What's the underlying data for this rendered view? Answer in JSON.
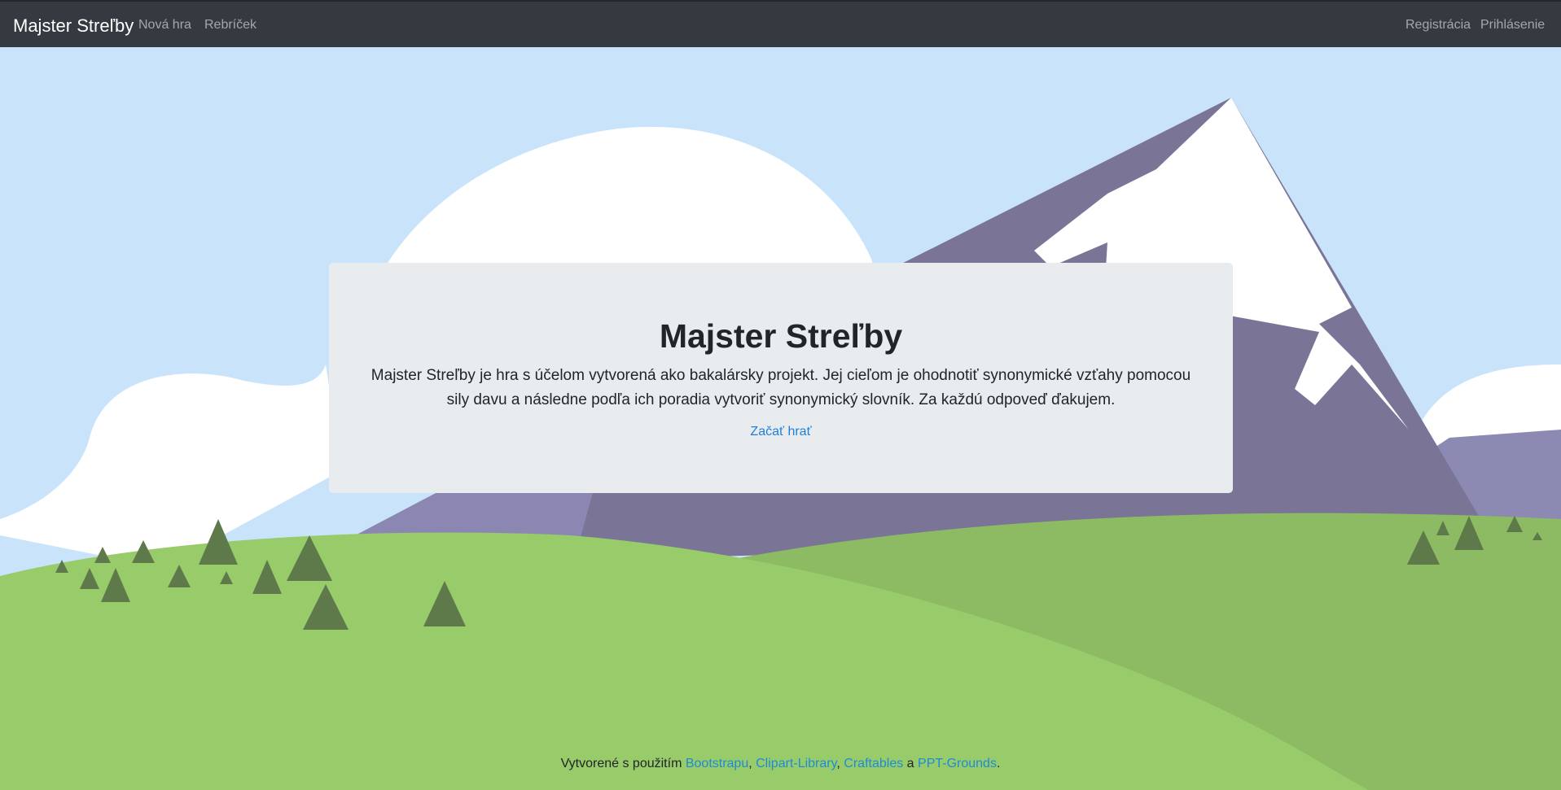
{
  "navbar": {
    "brand": "Majster Streľby",
    "links_left": [
      "Nová hra",
      "Rebríček"
    ],
    "links_right": [
      "Registrácia",
      "Prihlásenie"
    ]
  },
  "jumbotron": {
    "title": "Majster Streľby",
    "description": "Majster Streľby je hra s účelom vytvorená ako bakalársky projekt. Jej cieľom je ohodnotiť synonymické vzťahy pomocou sily davu a následne podľa ich poradia vytvoriť synonymický slovník. Za každú odpoveď ďakujem.",
    "cta": "Začať hrať"
  },
  "footer": {
    "prefix": "Vytvorené s použitím ",
    "links": [
      "Bootstrapu",
      "Clipart-Library",
      "Craftables",
      "PPT-Grounds"
    ],
    "sep1": ", ",
    "sep2": ", ",
    "sep3": " a ",
    "suffix": "."
  },
  "colors": {
    "navbar_bg": "#343a40",
    "sky": "#c9e3fb",
    "grass": "#98cb6a",
    "mountain": "#7a7597",
    "link": "#1e7fd6"
  }
}
